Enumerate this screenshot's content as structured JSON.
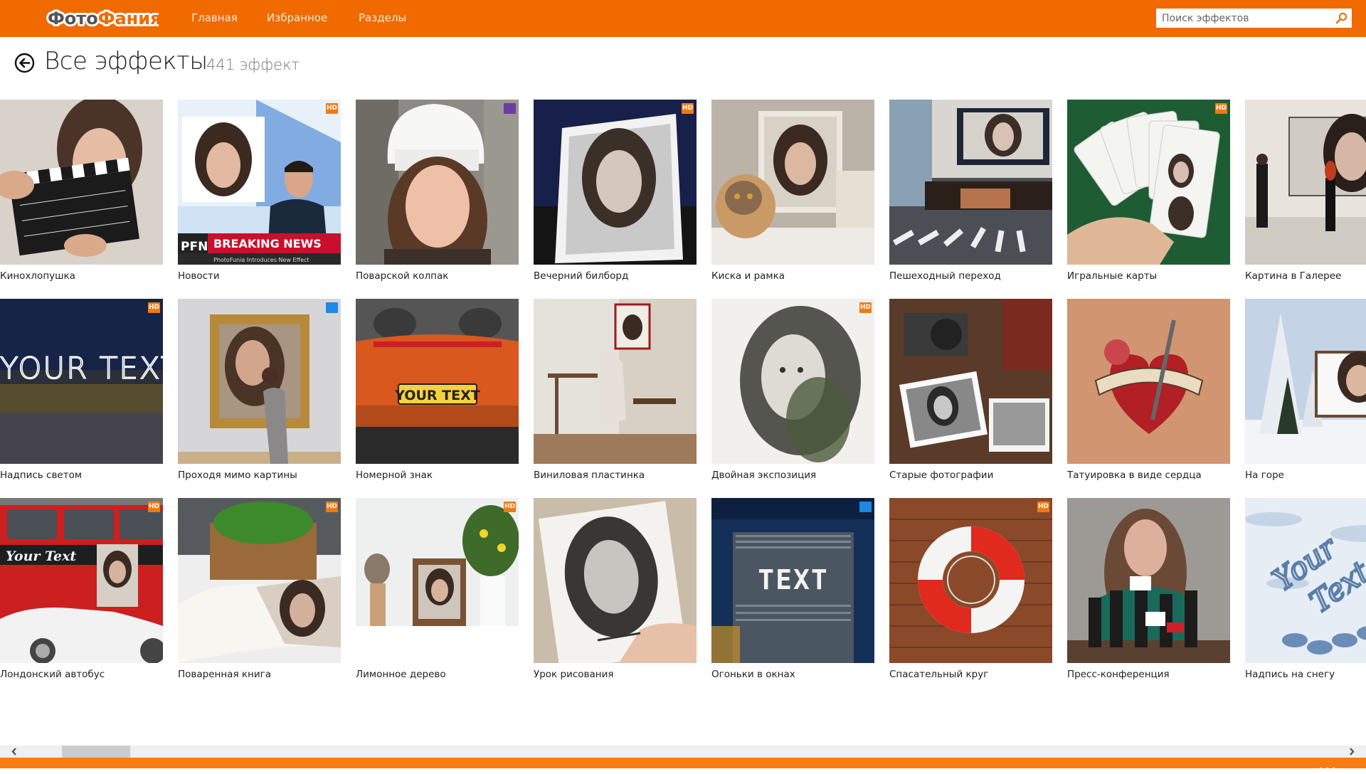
{
  "app": {
    "logo_part1": "Фото",
    "logo_part2": "Фания",
    "nav": [
      {
        "label": "Главная"
      },
      {
        "label": "Избранное"
      },
      {
        "label": "Разделы"
      }
    ],
    "search": {
      "placeholder": "Поиск эффектов",
      "value": ""
    },
    "colors": {
      "accent": "#f06a00",
      "hd_badge": "#f07a12",
      "video_badge": "#1e88e5",
      "face_badge": "#6a3fa0"
    }
  },
  "page": {
    "title": "Все эффекты",
    "count": "441 эффект"
  },
  "tiles": [
    {
      "label": "Кинохлопушка",
      "badge": "",
      "scene": "clapper"
    },
    {
      "label": "Новости",
      "badge": "HD",
      "scene": "news"
    },
    {
      "label": "Поварской колпак",
      "badge": "face",
      "scene": "chef"
    },
    {
      "label": "Вечерний билборд",
      "badge": "HD",
      "scene": "billboard"
    },
    {
      "label": "Киска и рамка",
      "badge": "",
      "scene": "cat"
    },
    {
      "label": "Пешеходный переход",
      "badge": "",
      "scene": "crossing"
    },
    {
      "label": "Игральные карты",
      "badge": "HD",
      "scene": "cards"
    },
    {
      "label": "Картина в Галерее",
      "badge": "",
      "scene": "gallery"
    },
    {
      "label": "Надпись светом",
      "badge": "HD",
      "scene": "lighttext"
    },
    {
      "label": "Проходя мимо картины",
      "badge": "video",
      "scene": "painting"
    },
    {
      "label": "Номерной знак",
      "badge": "",
      "scene": "plate"
    },
    {
      "label": "Виниловая пластинка",
      "badge": "",
      "scene": "vinyl"
    },
    {
      "label": "Двойная экспозиция",
      "badge": "HD",
      "scene": "double"
    },
    {
      "label": "Старые фотографии",
      "badge": "",
      "scene": "oldphotos"
    },
    {
      "label": "Татуировка в виде сердца",
      "badge": "",
      "scene": "tattoo"
    },
    {
      "label": "На горе",
      "badge": "",
      "scene": "mountain"
    },
    {
      "label": "Лондонский автобус",
      "badge": "HD",
      "scene": "bus"
    },
    {
      "label": "Поваренная книга",
      "badge": "HD",
      "scene": "cookbook"
    },
    {
      "label": "Лимонное дерево",
      "badge": "HD",
      "scene": "lemon"
    },
    {
      "label": "Урок рисования",
      "badge": "",
      "scene": "drawing"
    },
    {
      "label": "Огоньки в окнах",
      "badge": "video",
      "scene": "windows"
    },
    {
      "label": "Спасательный круг",
      "badge": "HD",
      "scene": "lifebuoy"
    },
    {
      "label": "Пресс-конференция",
      "badge": "",
      "scene": "press"
    },
    {
      "label": "Надпись на снегу",
      "badge": "",
      "scene": "snow"
    }
  ],
  "thumb_text": {
    "news_banner": "BREAKING NEWS",
    "news_logo": "PFN",
    "news_sub": "PhotoFunia Introduces New Effect",
    "your_text": "YOUR TEXT",
    "your_text_script": "Your Text",
    "text": "TEXT"
  },
  "badge_hd_label": "HD",
  "more_label": "..."
}
